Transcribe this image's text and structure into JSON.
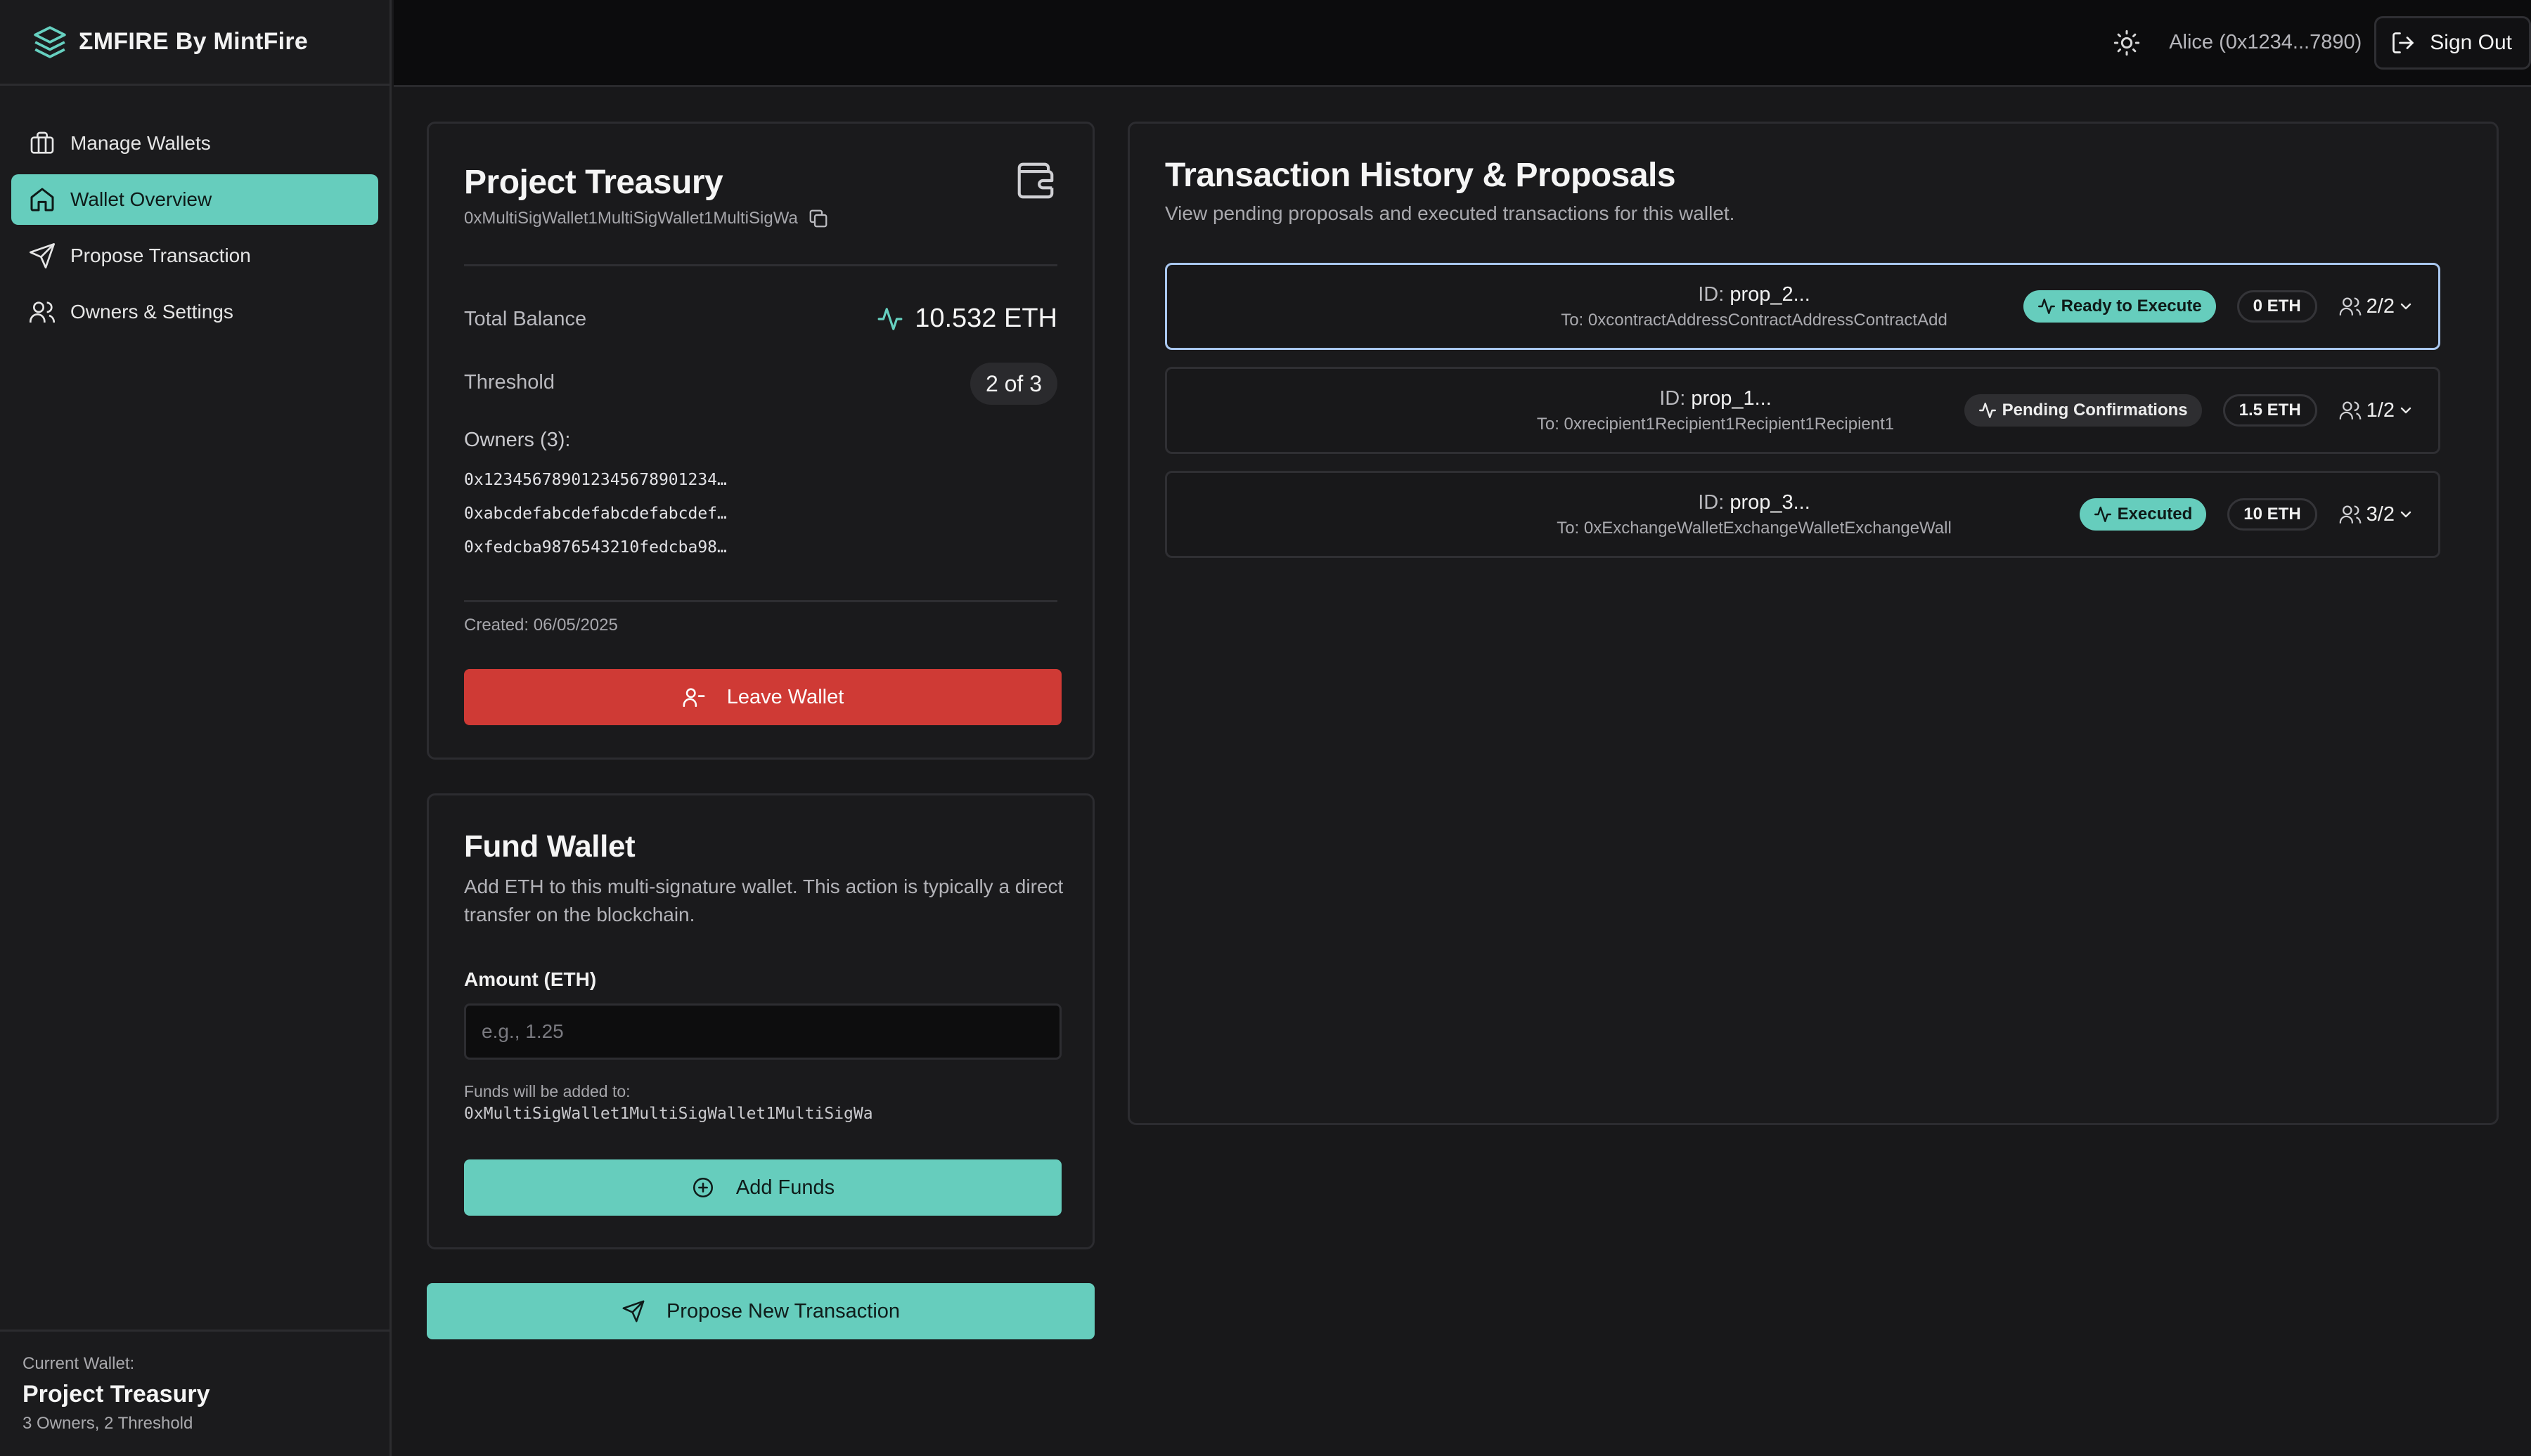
{
  "brand": {
    "name": "ΣMFIRE By MintFire",
    "accent": "#66cdbd"
  },
  "sidebar": {
    "items": [
      {
        "label": "Manage Wallets",
        "icon": "briefcase-icon",
        "active": false
      },
      {
        "label": "Wallet Overview",
        "icon": "home-icon",
        "active": true
      },
      {
        "label": "Propose Transaction",
        "icon": "send-icon",
        "active": false
      },
      {
        "label": "Owners & Settings",
        "icon": "users-icon",
        "active": false
      }
    ],
    "current_wallet": {
      "label": "Current Wallet:",
      "name": "Project Treasury",
      "meta": "3 Owners, 2 Threshold"
    }
  },
  "topbar": {
    "user": "Alice (0x1234...7890)",
    "sign_out": "Sign Out"
  },
  "treasury": {
    "title": "Project Treasury",
    "address": "0xMultiSigWallet1MultiSigWallet1MultiSigWa",
    "balance_label": "Total Balance",
    "balance": "10.532 ETH",
    "threshold_label": "Threshold",
    "threshold": "2 of 3",
    "owners_title": "Owners (3):",
    "owners": [
      "0x12345678901234567890123​4…",
      "0xabcdefabcdefabcdefabcdef…",
      "0xfedcba9876543210fedcba98…"
    ],
    "created": "Created: 06/05/2025",
    "leave_button": "Leave Wallet",
    "danger_color": "#cf3a35"
  },
  "fund": {
    "title": "Fund Wallet",
    "description": "Add ETH to this multi-signature wallet. This action is typically a direct transfer on the blockchain.",
    "amount_label": "Amount (ETH)",
    "amount_value": "",
    "amount_placeholder": "e.g., 1.25",
    "note": "Funds will be added to:",
    "note_address": "0xMultiSigWallet1MultiSigWallet1MultiSigWa",
    "add_button": "Add Funds"
  },
  "propose_button": "Propose New Transaction",
  "history": {
    "title": "Transaction History & Proposals",
    "subtitle": "View pending proposals and executed transactions for this wallet.",
    "id_prefix": "ID:",
    "proposals": [
      {
        "id": "prop_2...",
        "to": "To: 0xcontractAddressContractAddressContractAdd",
        "status": "Ready to Execute",
        "status_style": "teal",
        "amount": "0 ETH",
        "signatures": "2/2",
        "selected": true
      },
      {
        "id": "prop_1...",
        "to": "To: 0xrecipient1Recipient1Recipient1Recipient1",
        "status": "Pending Confirmations",
        "status_style": "gray",
        "amount": "1.5 ETH",
        "signatures": "1/2",
        "selected": false
      },
      {
        "id": "prop_3...",
        "to": "To: 0xExchangeWalletExchangeWalletExchangeWall",
        "status": "Executed",
        "status_style": "teal",
        "amount": "10 ETH",
        "signatures": "3/2",
        "selected": false
      }
    ]
  }
}
